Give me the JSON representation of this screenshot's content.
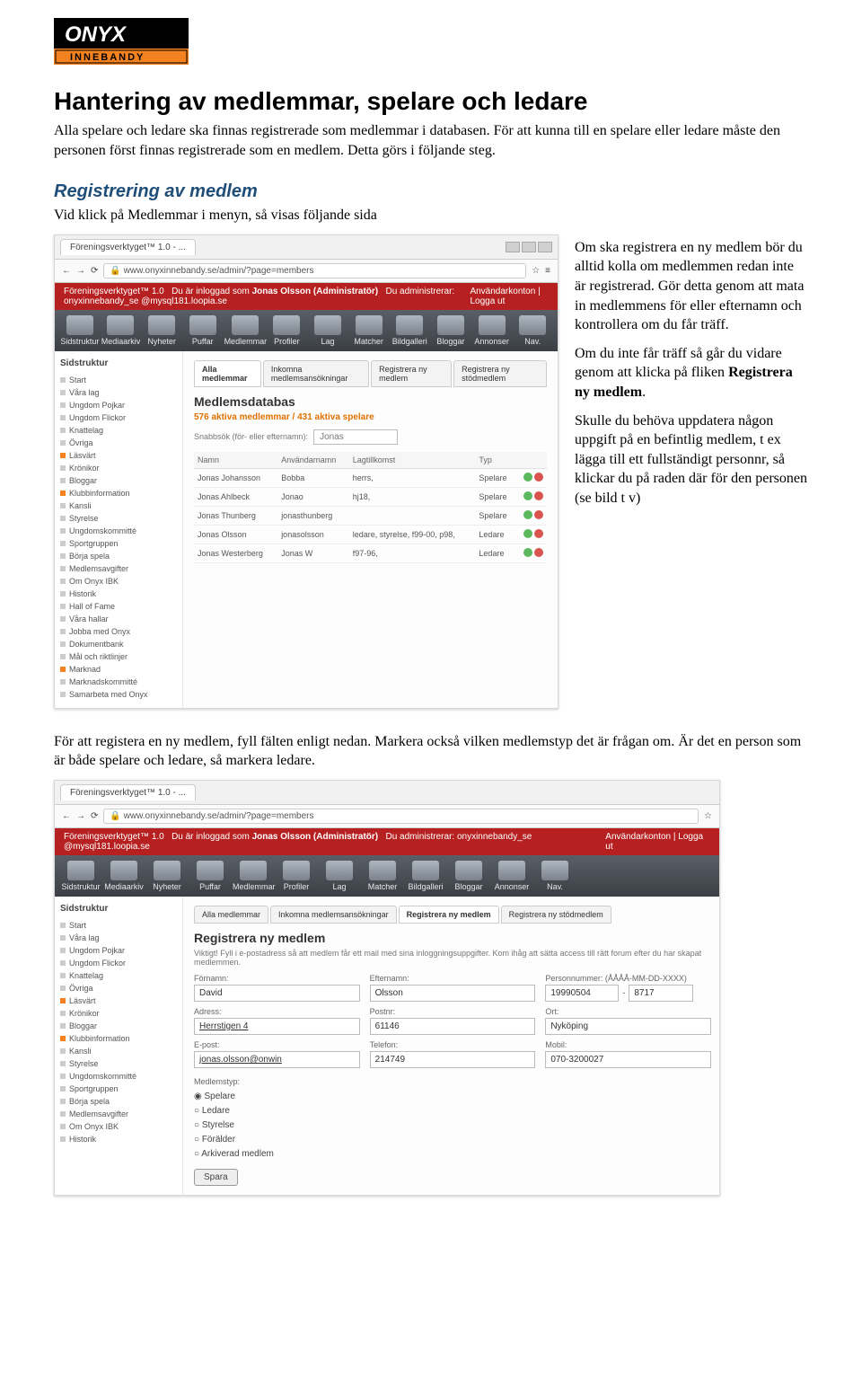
{
  "logo": {
    "top": "ONYX",
    "bottom": "INNEBANDY"
  },
  "title": "Hantering av medlemmar, spelare och ledare",
  "intro1": "Alla spelare och ledare ska finnas registrerade som medlemmar i databasen. För att kunna till en spelare eller ledare måste den personen först finnas registrerade som en medlem. Detta görs i följande steg.",
  "section1_title": "Registrering av medlem",
  "section1_lead": "Vid klick på Medlemmar i menyn, så visas följande sida",
  "side_paras": {
    "p1": "Om ska registrera en ny medlem bör du alltid kolla om medlemmen redan inte är registrerad. Gör detta genom att mata in medlemmens för eller efternamn och kontrollera om du får träff.",
    "p2a": "Om du inte får träff så går du vidare genom att klicka på fliken ",
    "p2b": "Registrera ny medlem",
    "p2c": ".",
    "p3": "Skulle du behöva uppdatera någon uppgift på en befintlig medlem, t ex lägga till ett fullständigt personnr, så klickar du på raden där för den personen (se bild t v)"
  },
  "between_para": "För att registera en ny medlem, fyll fälten enligt nedan. Markera också vilken medlemstyp det är frågan om. Är det en person som är både spelare och ledare, så markera ledare.",
  "browser_tab": "Föreningsverktyget™ 1.0 - ...",
  "url": "www.onyxinnebandy.se/admin/?page=members",
  "redbar": {
    "app": "Föreningsverktyget™ 1.0",
    "login1": "Du är inloggad som ",
    "login2": "Jonas Olsson (Administratör)",
    "admin": "Du administrerar: onyxinnebandy_se @mysql181.loopia.se",
    "menu_user": "Användarkonton",
    "menu_logout": "Logga ut"
  },
  "nav": [
    "Sidstruktur",
    "Mediaarkiv",
    "Nyheter",
    "Puffar",
    "Medlemmar",
    "Profiler",
    "Lag",
    "Matcher",
    "Bildgalleri",
    "Bloggar",
    "Annonser",
    "Nav."
  ],
  "sidebar_title": "Sidstruktur",
  "sidebar_items": [
    {
      "c": "g",
      "t": "Start"
    },
    {
      "c": "g",
      "t": "Våra lag"
    },
    {
      "c": "g",
      "t": "Ungdom Pojkar"
    },
    {
      "c": "g",
      "t": "Ungdom Flickor"
    },
    {
      "c": "g",
      "t": "Knattelag"
    },
    {
      "c": "g",
      "t": "Övriga"
    },
    {
      "c": "o",
      "t": "Läsvärt"
    },
    {
      "c": "g",
      "t": "Krönikor"
    },
    {
      "c": "g",
      "t": "Bloggar"
    },
    {
      "c": "o",
      "t": "Klubbinformation"
    },
    {
      "c": "g",
      "t": "Kansli"
    },
    {
      "c": "g",
      "t": "Styrelse"
    },
    {
      "c": "g",
      "t": "Ungdomskommitté"
    },
    {
      "c": "g",
      "t": "Sportgruppen"
    },
    {
      "c": "g",
      "t": "Börja spela"
    },
    {
      "c": "g",
      "t": "Medlemsavgifter"
    },
    {
      "c": "g",
      "t": "Om Onyx IBK"
    },
    {
      "c": "g",
      "t": "Historik"
    },
    {
      "c": "g",
      "t": "Hall of Fame"
    },
    {
      "c": "g",
      "t": "Våra hallar"
    },
    {
      "c": "g",
      "t": "Jobba med Onyx"
    },
    {
      "c": "g",
      "t": "Dokumentbank"
    },
    {
      "c": "g",
      "t": "Mål och riktlinjer"
    },
    {
      "c": "o",
      "t": "Marknad"
    },
    {
      "c": "g",
      "t": "Marknadskommitté"
    },
    {
      "c": "g",
      "t": "Samarbeta med Onyx"
    }
  ],
  "tabs1": [
    "Alla medlemmar",
    "Inkomna medlemsansökningar",
    "Registrera ny medlem",
    "Registrera ny stödmedlem"
  ],
  "shot1": {
    "title": "Medlemsdatabas",
    "sub": "576 aktiva medlemmar / 431 aktiva spelare",
    "search_label": "Snabbsök (för- eller efternamn):",
    "search_value": "Jonas",
    "cols": [
      "Namn",
      "Användarnamn",
      "Lagtillkomst",
      "Typ",
      ""
    ],
    "rows": [
      {
        "n": "Jonas Johansson",
        "u": "Bobba",
        "l": "herrs,",
        "t": "Spelare"
      },
      {
        "n": "Jonas Ahlbeck",
        "u": "Jonao",
        "l": "hj18,",
        "t": "Spelare"
      },
      {
        "n": "Jonas Thunberg",
        "u": "jonasthunberg",
        "l": "",
        "t": "Spelare"
      },
      {
        "n": "Jonas Olsson",
        "u": "jonasolsson",
        "l": "ledare, styrelse, f99-00, p98,",
        "t": "Ledare"
      },
      {
        "n": "Jonas Westerberg",
        "u": "Jonas W",
        "l": "f97-96,",
        "t": "Ledare"
      }
    ]
  },
  "tabs2_active": 2,
  "shot2": {
    "title": "Registrera ny medlem",
    "help": "Viktigt! Fyll i e-postadress så att medlem får ett mail med sina inloggningsuppgifter. Kom ihåg att sätta access till rätt forum efter du har skapat medlemmen.",
    "labels": {
      "fornamn": "Förnamn:",
      "efternamn": "Efternamn:",
      "pn": "Personnummer: (ÅÅÅÅ-MM-DD-XXXX)",
      "adress": "Adress:",
      "postnr": "Postnr:",
      "ort": "Ort:",
      "epost": "E-post:",
      "tel": "Telefon:",
      "mobil": "Mobil:",
      "mtyp": "Medlemstyp:"
    },
    "values": {
      "fornamn": "David",
      "efternamn": "Olsson",
      "pn1": "19990504",
      "pn2": "8717",
      "adress": "Herrstigen 4",
      "postnr": "61146",
      "ort": "Nyköping",
      "epost": "jonas.olsson@onwin",
      "tel": "214749",
      "mobil": "070-3200027"
    },
    "radios": [
      "Spelare",
      "Ledare",
      "Styrelse",
      "Förälder",
      "Arkiverad medlem"
    ],
    "save": "Spara"
  }
}
